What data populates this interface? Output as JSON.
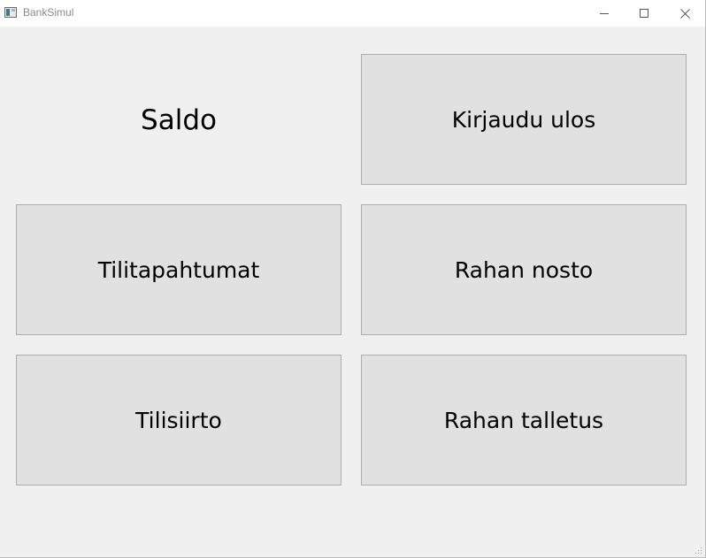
{
  "window": {
    "title": "BankSimul",
    "icons": {
      "app": "window-app-icon",
      "minimize": "minimize-icon",
      "maximize": "maximize-icon",
      "close": "close-icon",
      "resize": "resize-grip-icon"
    }
  },
  "main": {
    "balance_label": "Saldo",
    "buttons": {
      "logout": "Kirjaudu ulos",
      "transactions": "Tilitapahtumat",
      "withdraw": "Rahan nosto",
      "transfer": "Tilisiirto",
      "deposit": "Rahan talletus"
    }
  },
  "colors": {
    "background": "#f0f0f0",
    "button_face": "#e1e1e1",
    "button_border": "#adadad",
    "titlebar": "#ffffff"
  }
}
